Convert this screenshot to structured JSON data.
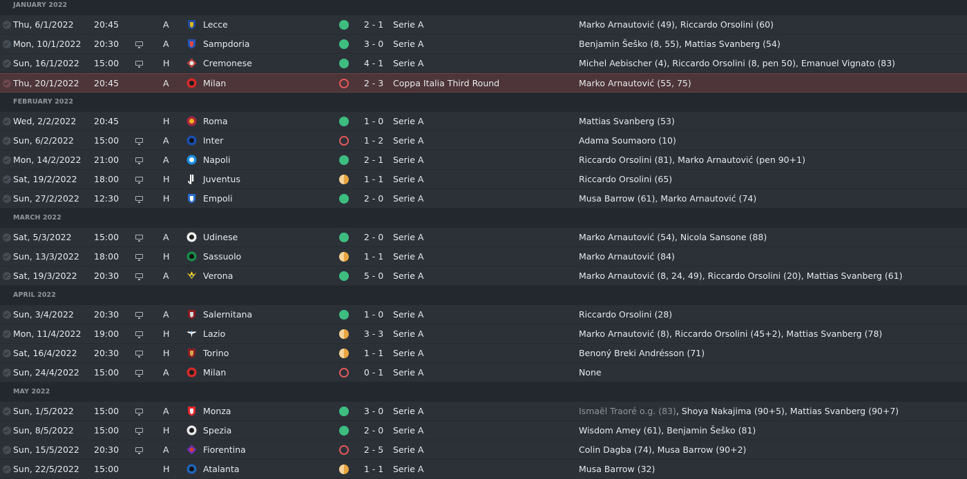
{
  "months": [
    {
      "label": "JANUARY 2022",
      "matches": [
        {
          "date": "Thu, 6/1/2022",
          "time": "20:45",
          "tv": false,
          "venue": "A",
          "opponent": "Lecce",
          "badge": {
            "shape": "shield",
            "c1": "#1f4b96",
            "c2": "#d9b52a"
          },
          "result": "w",
          "score": "2 - 1",
          "competition": "Serie A",
          "scorers": [
            {
              "text": "Marko Arnautović (49), Riccardo Orsolini (60)"
            }
          ],
          "highlight": false
        },
        {
          "date": "Mon, 10/1/2022",
          "time": "20:30",
          "tv": true,
          "venue": "A",
          "opponent": "Sampdoria",
          "badge": {
            "shape": "shield",
            "c1": "#2356b8",
            "c2": "#e84848"
          },
          "result": "w",
          "score": "3 - 0",
          "competition": "Serie A",
          "scorers": [
            {
              "text": "Benjamin Šeško (8, 55), Mattias Svanberg (54)"
            }
          ],
          "highlight": false
        },
        {
          "date": "Sun, 16/1/2022",
          "time": "15:00",
          "tv": true,
          "venue": "H",
          "opponent": "Cremonese",
          "badge": {
            "shape": "diamond",
            "c1": "#b5423c",
            "c2": "#e8e8e8"
          },
          "result": "w",
          "score": "4 - 1",
          "competition": "Serie A",
          "scorers": [
            {
              "text": "Michel Aebischer (4), Riccardo Orsolini (8, pen 50), Emanuel Vignato (83)"
            }
          ],
          "highlight": false
        },
        {
          "date": "Thu, 20/1/2022",
          "time": "20:45",
          "tv": false,
          "venue": "A",
          "opponent": "Milan",
          "badge": {
            "shape": "circle",
            "c1": "#d42a2a",
            "c2": "#1b1b1b"
          },
          "result": "l",
          "score": "2 - 3",
          "competition": "Coppa Italia Third Round",
          "scorers": [
            {
              "text": "Marko Arnautović (55, 75)"
            }
          ],
          "highlight": true
        }
      ]
    },
    {
      "label": "FEBRUARY 2022",
      "matches": [
        {
          "date": "Wed, 2/2/2022",
          "time": "20:45",
          "tv": false,
          "venue": "H",
          "opponent": "Roma",
          "badge": {
            "shape": "circle",
            "c1": "#a8263e",
            "c2": "#f1b51c"
          },
          "result": "w",
          "score": "1 - 0",
          "competition": "Serie A",
          "scorers": [
            {
              "text": "Mattias Svanberg (53)"
            }
          ],
          "highlight": false
        },
        {
          "date": "Sun, 6/2/2022",
          "time": "15:00",
          "tv": true,
          "venue": "A",
          "opponent": "Inter",
          "badge": {
            "shape": "circle",
            "c1": "#1a4fae",
            "c2": "#111111"
          },
          "result": "l",
          "score": "1 - 2",
          "competition": "Serie A",
          "scorers": [
            {
              "text": "Adama Soumaoro (10)"
            }
          ],
          "highlight": false
        },
        {
          "date": "Mon, 14/2/2022",
          "time": "21:00",
          "tv": true,
          "venue": "A",
          "opponent": "Napoli",
          "badge": {
            "shape": "circle",
            "c1": "#1d8fe0",
            "c2": "#ffffff"
          },
          "result": "w",
          "score": "2 - 1",
          "competition": "Serie A",
          "scorers": [
            {
              "text": "Riccardo Orsolini (81), Marko Arnautović (pen 90+1)"
            }
          ],
          "highlight": false
        },
        {
          "date": "Sat, 19/2/2022",
          "time": "18:00",
          "tv": true,
          "venue": "H",
          "opponent": "Juventus",
          "badge": {
            "shape": "juve",
            "c1": "#ffffff",
            "c2": "#23282e"
          },
          "result": "d",
          "score": "1 - 1",
          "competition": "Serie A",
          "scorers": [
            {
              "text": "Riccardo Orsolini (65)"
            }
          ],
          "highlight": false
        },
        {
          "date": "Sun, 27/2/2022",
          "time": "12:30",
          "tv": true,
          "venue": "H",
          "opponent": "Empoli",
          "badge": {
            "shape": "shield",
            "c1": "#2a6cc7",
            "c2": "#ffffff"
          },
          "result": "w",
          "score": "2 - 0",
          "competition": "Serie A",
          "scorers": [
            {
              "text": "Musa Barrow (61), Marko Arnautović (74)"
            }
          ],
          "highlight": false
        }
      ]
    },
    {
      "label": "MARCH 2022",
      "matches": [
        {
          "date": "Sat, 5/3/2022",
          "time": "15:00",
          "tv": true,
          "venue": "A",
          "opponent": "Udinese",
          "badge": {
            "shape": "circle",
            "c1": "#f0f0f0",
            "c2": "#222222"
          },
          "result": "w",
          "score": "2 - 0",
          "competition": "Serie A",
          "scorers": [
            {
              "text": "Marko Arnautović (54), Nicola Sansone (88)"
            }
          ],
          "highlight": false
        },
        {
          "date": "Sun, 13/3/2022",
          "time": "18:00",
          "tv": true,
          "venue": "H",
          "opponent": "Sassuolo",
          "badge": {
            "shape": "circle",
            "c1": "#1a8a48",
            "c2": "#111111"
          },
          "result": "d",
          "score": "1 - 1",
          "competition": "Serie A",
          "scorers": [
            {
              "text": "Marko Arnautović (84)"
            }
          ],
          "highlight": false
        },
        {
          "date": "Sat, 19/3/2022",
          "time": "20:30",
          "tv": true,
          "venue": "A",
          "opponent": "Verona",
          "badge": {
            "shape": "verona",
            "c1": "#f2d21a",
            "c2": "#1b3a8c"
          },
          "result": "w",
          "score": "5 - 0",
          "competition": "Serie A",
          "scorers": [
            {
              "text": "Marko Arnautović (8, 24, 49), Riccardo Orsolini (20), Mattias Svanberg (61)"
            }
          ],
          "highlight": false
        }
      ]
    },
    {
      "label": "APRIL 2022",
      "matches": [
        {
          "date": "Sun, 3/4/2022",
          "time": "20:30",
          "tv": true,
          "venue": "A",
          "opponent": "Salernitana",
          "badge": {
            "shape": "shield",
            "c1": "#8c1c1f",
            "c2": "#d8d8d8"
          },
          "result": "w",
          "score": "1 - 0",
          "competition": "Serie A",
          "scorers": [
            {
              "text": "Riccardo Orsolini (28)"
            }
          ],
          "highlight": false
        },
        {
          "date": "Mon, 11/4/2022",
          "time": "19:00",
          "tv": true,
          "venue": "H",
          "opponent": "Lazio",
          "badge": {
            "shape": "eagle",
            "c1": "#8cc6ee",
            "c2": "#ffffff"
          },
          "result": "d",
          "score": "3 - 3",
          "competition": "Serie A",
          "scorers": [
            {
              "text": "Marko Arnautović (8), Riccardo Orsolini (45+2), Mattias Svanberg (78)"
            }
          ],
          "highlight": false
        },
        {
          "date": "Sat, 16/4/2022",
          "time": "20:30",
          "tv": true,
          "venue": "H",
          "opponent": "Torino",
          "badge": {
            "shape": "shield",
            "c1": "#8b1e24",
            "c2": "#d8a64a"
          },
          "result": "d",
          "score": "1 - 1",
          "competition": "Serie A",
          "scorers": [
            {
              "text": "Benoný Breki Andrésson (71)"
            }
          ],
          "highlight": false
        },
        {
          "date": "Sun, 24/4/2022",
          "time": "15:00",
          "tv": true,
          "venue": "A",
          "opponent": "Milan",
          "badge": {
            "shape": "circle",
            "c1": "#d42a2a",
            "c2": "#1b1b1b"
          },
          "result": "l",
          "score": "0 - 1",
          "competition": "Serie A",
          "scorers": [
            {
              "text": "None"
            }
          ],
          "highlight": false
        }
      ]
    },
    {
      "label": "MAY 2022",
      "matches": [
        {
          "date": "Sun, 1/5/2022",
          "time": "15:00",
          "tv": true,
          "venue": "A",
          "opponent": "Monza",
          "badge": {
            "shape": "shield",
            "c1": "#e0262c",
            "c2": "#ffffff"
          },
          "result": "w",
          "score": "3 - 0",
          "competition": "Serie A",
          "scorers": [
            {
              "text": "Ismaël Traoré o.g. (83)",
              "og": true
            },
            {
              "text": ", Shoya Nakajima (90+5), Mattias Svanberg (90+7)"
            }
          ],
          "highlight": false
        },
        {
          "date": "Sun, 8/5/2022",
          "time": "15:00",
          "tv": true,
          "venue": "H",
          "opponent": "Spezia",
          "badge": {
            "shape": "circle",
            "c1": "#e6e6e6",
            "c2": "#1b1b1b"
          },
          "result": "w",
          "score": "2 - 0",
          "competition": "Serie A",
          "scorers": [
            {
              "text": "Wisdom Amey (61), Benjamin Šeško (81)"
            }
          ],
          "highlight": false
        },
        {
          "date": "Sun, 15/5/2022",
          "time": "20:30",
          "tv": true,
          "venue": "A",
          "opponent": "Fiorentina",
          "badge": {
            "shape": "diamond",
            "c1": "#6a2fb5",
            "c2": "#d83a3a"
          },
          "result": "l",
          "score": "2 - 5",
          "competition": "Serie A",
          "scorers": [
            {
              "text": "Colin Dagba (74), Musa Barrow (90+2)"
            }
          ],
          "highlight": false
        },
        {
          "date": "Sun, 22/5/2022",
          "time": "15:00",
          "tv": false,
          "venue": "H",
          "opponent": "Atalanta",
          "badge": {
            "shape": "circle",
            "c1": "#1e63b8",
            "c2": "#111111"
          },
          "result": "d",
          "score": "1 - 1",
          "competition": "Serie A",
          "scorers": [
            {
              "text": "Musa Barrow (32)"
            }
          ],
          "highlight": false
        }
      ]
    }
  ]
}
